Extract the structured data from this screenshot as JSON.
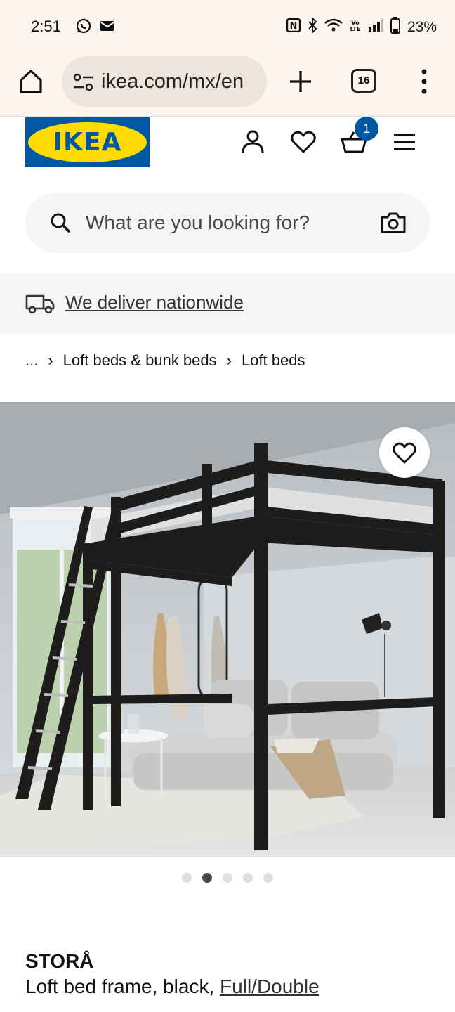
{
  "status_bar": {
    "time": "2:51",
    "battery": "23%",
    "left_icons": [
      "whatsapp-icon",
      "mail-icon"
    ],
    "right_icons": [
      "nfc-icon",
      "bluetooth-icon",
      "wifi-icon",
      "volte-icon",
      "signal-icon",
      "battery-icon"
    ]
  },
  "browser": {
    "url": "ikea.com/mx/en",
    "tab_count": "16"
  },
  "header": {
    "logo_text": "IKEA",
    "cart_count": "1"
  },
  "search": {
    "placeholder": "What are you looking for?"
  },
  "delivery": {
    "text": "We deliver nationwide"
  },
  "breadcrumb": {
    "ellipsis": "...",
    "items": [
      "Loft beds & bunk beds",
      "Loft beds"
    ]
  },
  "gallery": {
    "current_index": 2,
    "total": 5
  },
  "product": {
    "name": "STORÅ",
    "description": "Loft bed frame, black,",
    "size": "Full/Double"
  },
  "colors": {
    "ikea_blue": "#0058a3",
    "ikea_yellow": "#ffdb00",
    "browser_bg": "#fbf4ef"
  }
}
